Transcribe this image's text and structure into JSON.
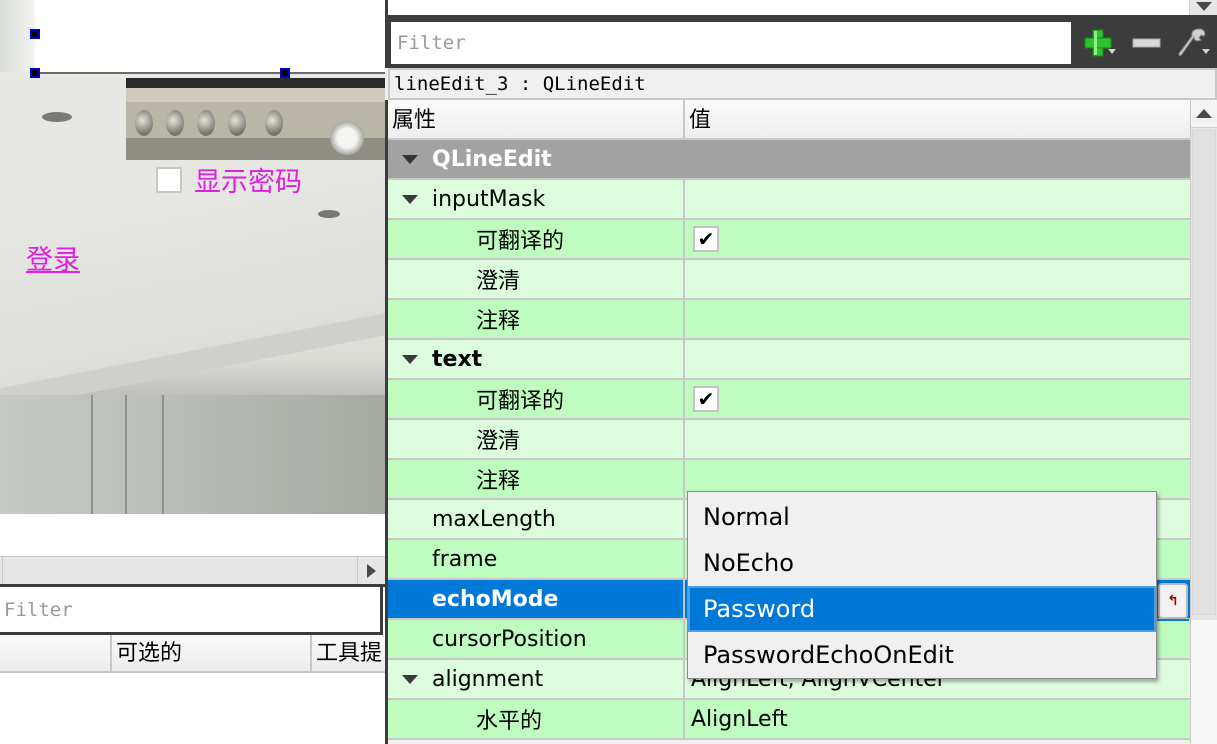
{
  "form_preview": {
    "show_password_label": "显示密码",
    "show_password_checked": false,
    "login_link": "登录"
  },
  "signal_panel": {
    "filter_placeholder": "Filter",
    "columns": [
      "",
      "可选的",
      "工具提"
    ]
  },
  "property_editor": {
    "filter_placeholder": "Filter",
    "toolbar": {
      "add_icon": "plus-icon",
      "remove_icon": "minus-icon",
      "configure_icon": "wrench-icon"
    },
    "object_label": "lineEdit_3 : QLineEdit",
    "headers": {
      "property": "属性",
      "value": "值"
    },
    "rows": [
      {
        "key": "QLineEdit",
        "value": "",
        "type": "group",
        "expanded": true,
        "indent": 0
      },
      {
        "key": "inputMask",
        "value": "",
        "type": "light",
        "expanded": true,
        "indent": 0
      },
      {
        "key": "可翻译的",
        "value": "",
        "checkbox": true,
        "checked": true,
        "type": "dark",
        "indent": 2
      },
      {
        "key": "澄清",
        "value": "",
        "type": "light",
        "indent": 2
      },
      {
        "key": "注释",
        "value": "",
        "type": "dark",
        "indent": 2
      },
      {
        "key": "text",
        "value": "",
        "type": "light",
        "expanded": true,
        "bold": true,
        "indent": 0
      },
      {
        "key": "可翻译的",
        "value": "",
        "checkbox": true,
        "checked": true,
        "type": "dark",
        "indent": 2
      },
      {
        "key": "澄清",
        "value": "",
        "type": "light",
        "indent": 2
      },
      {
        "key": "注释",
        "value": "",
        "type": "dark",
        "indent": 2
      },
      {
        "key": "maxLength",
        "value": "",
        "type": "light",
        "indent": 1
      },
      {
        "key": "frame",
        "value": "",
        "type": "dark",
        "indent": 1
      },
      {
        "key": "echoMode",
        "value": "Password",
        "type": "selected",
        "indent": 1
      },
      {
        "key": "cursorPosition",
        "value": "",
        "type": "dark",
        "indent": 1
      },
      {
        "key": "alignment",
        "value": "AlignLeft, AlignVCenter",
        "type": "light",
        "expanded": true,
        "indent": 0
      },
      {
        "key": "水平的",
        "value": "AlignLeft",
        "type": "dark",
        "indent": 2
      }
    ],
    "reset_icon": "reset-arrow-icon",
    "echo_mode_dropdown": {
      "options": [
        "Normal",
        "NoEcho",
        "Password",
        "PasswordEchoOnEdit"
      ],
      "selected": "Password"
    }
  }
}
